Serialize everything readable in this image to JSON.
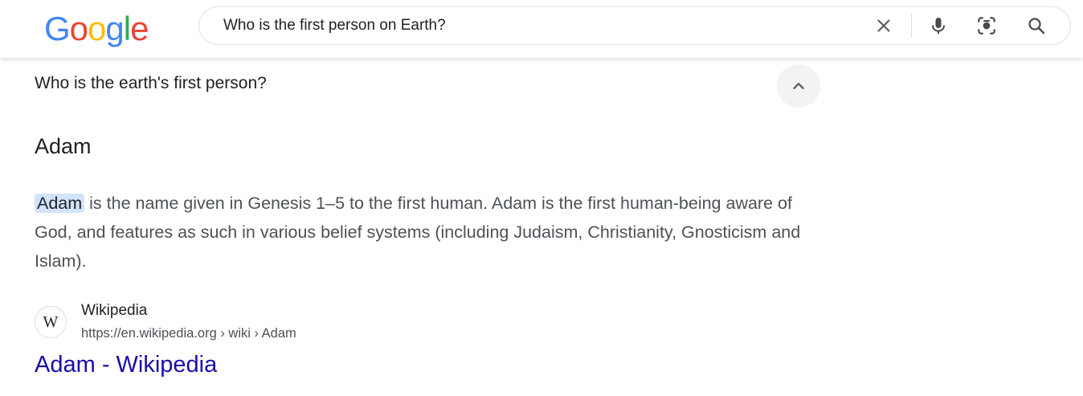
{
  "header": {
    "logo": {
      "letters": [
        "G",
        "o",
        "o",
        "g",
        "l",
        "e"
      ],
      "colors": [
        "#4285F4",
        "#EA4335",
        "#FBBC05",
        "#4285F4",
        "#34A853",
        "#EA4335"
      ]
    },
    "search": {
      "query": "Who is the first person on Earth?",
      "icons": [
        "close-icon",
        "mic-icon",
        "lens-icon",
        "search-icon"
      ]
    }
  },
  "answer": {
    "question": "Who is the earth's first person?",
    "title": "Adam",
    "snippet_highlight": "Adam",
    "snippet_rest": " is the name given in Genesis 1–5 to the first human. Adam is the first human-being aware of God, and features as such in various belief systems (including Judaism, Christianity, Gnosticism and Islam).",
    "source": {
      "icon_letter": "W",
      "name": "Wikipedia",
      "url": "https://en.wikipedia.org › wiki › Adam"
    },
    "link_title": "Adam - Wikipedia"
  },
  "colors": {
    "link": "#1a0dab",
    "highlight": "#d3e3fd",
    "text": "#202124",
    "secondary_text": "#4d5156"
  }
}
